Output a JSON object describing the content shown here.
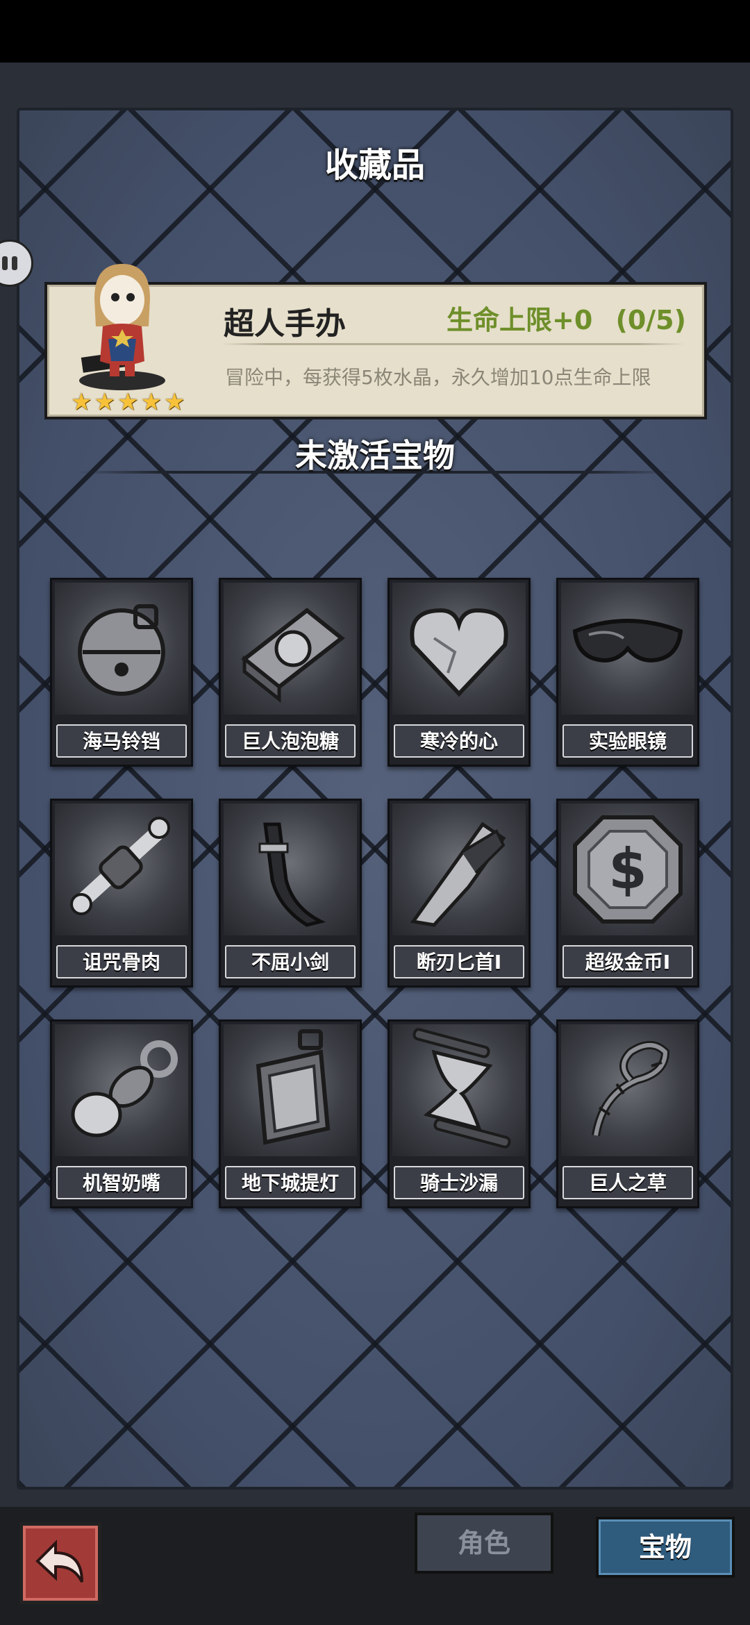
{
  "collection": {
    "title": "收藏品",
    "featured": {
      "name": "超人手办",
      "effect": "生命上限+0",
      "progress": "(0/5)",
      "description": "冒险中，每获得5枚水晶，永久增加10点生命上限",
      "stars": 5
    },
    "section_title": "未激活宝物",
    "items": [
      {
        "label": "海马铃铛",
        "icon": "bell-icon"
      },
      {
        "label": "巨人泡泡糖",
        "icon": "gum-pack-icon"
      },
      {
        "label": "寒冷的心",
        "icon": "stone-heart-icon"
      },
      {
        "label": "实验眼镜",
        "icon": "goggles-icon"
      },
      {
        "label": "诅咒骨肉",
        "icon": "bone-meat-icon"
      },
      {
        "label": "不屈小剑",
        "icon": "small-sword-icon"
      },
      {
        "label": "断刃匕首I",
        "icon": "broken-dagger-icon"
      },
      {
        "label": "超级金币I",
        "icon": "coin-icon"
      },
      {
        "label": "机智奶嘴",
        "icon": "pacifier-icon"
      },
      {
        "label": "地下城提灯",
        "icon": "lantern-icon"
      },
      {
        "label": "骑士沙漏",
        "icon": "hourglass-icon"
      },
      {
        "label": "巨人之草",
        "icon": "thorny-vine-icon"
      }
    ]
  },
  "bottom": {
    "back_icon": "back-arrow-icon",
    "tabs": [
      {
        "label": "角色",
        "active": false
      },
      {
        "label": "宝物",
        "active": true
      }
    ]
  },
  "colors": {
    "panel": "#4a5569",
    "effect_green": "#6e8f2a",
    "active_tab": "#2f5b7d",
    "back_button": "#a23b37"
  }
}
